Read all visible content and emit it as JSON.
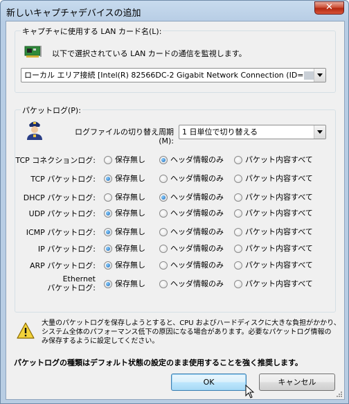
{
  "window": {
    "title": "新しいキャプチャデバイスの追加",
    "close_label": "✕"
  },
  "lan_group": {
    "legend": "キャプチャに使用する LAN カード名(L):",
    "description": "以下で選択されている LAN カードの通信を監視します。",
    "selected_card": "ローカル エリア接続 [Intel(R) 82566DC-2 Gigabit Network Connection (ID="
  },
  "packet_group": {
    "legend": "パケットログ(P):",
    "rotation_label": "ログファイルの切り替え周期(M):",
    "rotation_value": "1 日単位で切り替える",
    "options": [
      "保存無し",
      "ヘッダ情報のみ",
      "パケット内容すべて"
    ],
    "rows": [
      {
        "label": "TCP コネクションログ:",
        "selected": 1
      },
      {
        "label": "TCP パケットログ:",
        "selected": 0
      },
      {
        "label": "DHCP パケットログ:",
        "selected": 1
      },
      {
        "label": "UDP パケットログ:",
        "selected": 0
      },
      {
        "label": "ICMP パケットログ:",
        "selected": 0
      },
      {
        "label": "IP パケットログ:",
        "selected": 0
      },
      {
        "label": "ARP パケットログ:",
        "selected": 0
      },
      {
        "label_line1": "Ethernet",
        "label_line2": "パケットログ:",
        "selected": 0
      }
    ]
  },
  "warning": {
    "line1": "大量のパケットログを保存しようとすると、CPU およびハードディスクに大きな負担がかかり、",
    "line2": "システム全体のパフォーマンス低下の原因になる場合があります。必要なパケットログ情報の",
    "line3": "み保存するように設定してください。"
  },
  "recommendation": "パケットログの種類はデフォルト状態の設定のまま使用することを強く推奨します。",
  "buttons": {
    "ok": "OK",
    "cancel": "キャンセル"
  },
  "icons": {
    "nic": "network-card-icon",
    "officer": "police-officer-icon",
    "warning": "warning-icon"
  },
  "colors": {
    "accent": "#3c7fb1",
    "close": "#c8462d",
    "radio_selected": "#1864b5"
  }
}
